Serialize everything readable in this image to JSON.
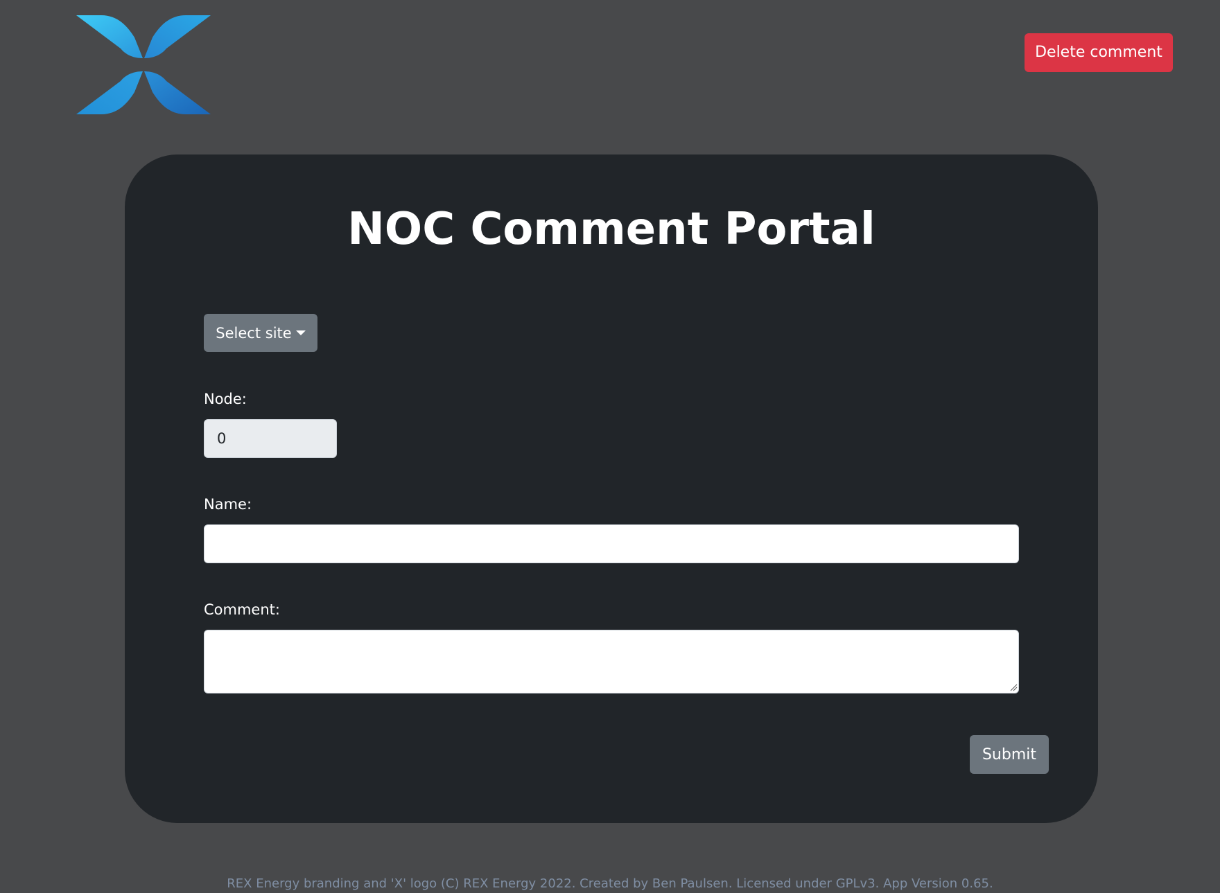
{
  "header": {
    "logo_icon": "rex-energy-x-logo-icon",
    "delete_label": "Delete comment",
    "delete_color": "#dc3545"
  },
  "form": {
    "title": "NOC Comment Portal",
    "site_select_label": "Select site",
    "node_label": "Node:",
    "node_value": "0",
    "name_label": "Name:",
    "name_value": "",
    "comment_label": "Comment:",
    "comment_value": "",
    "submit_label": "Submit"
  },
  "footer": {
    "text": "REX Energy branding and 'X' logo (C) REX Energy 2022. Created by Ben Paulsen. Licensed under GPLv3. App Version 0.65."
  },
  "colors": {
    "page_background": "#48494b",
    "card_background": "#212529",
    "secondary_button": "#6c757d",
    "logo_light": "#38c6f4",
    "logo_dark": "#1c6fbd"
  }
}
